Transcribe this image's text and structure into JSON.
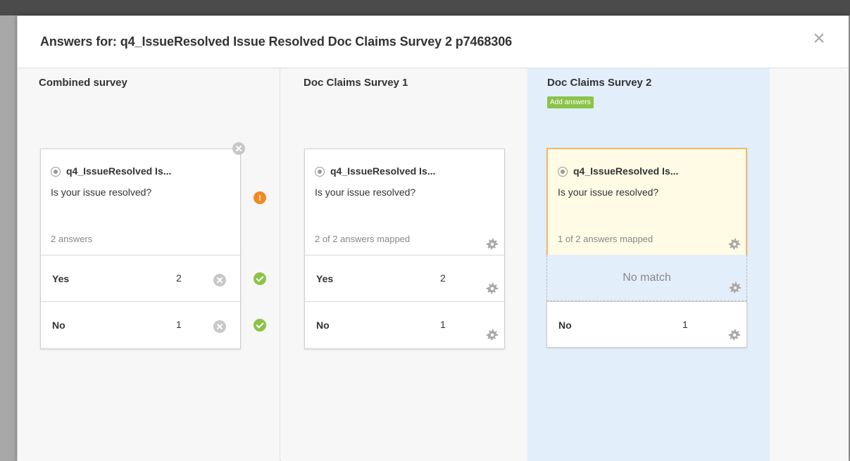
{
  "modal": {
    "title": "Answers for: q4_IssueResolved Issue Resolved Doc Claims Survey 2 p7468306",
    "close_label": "×"
  },
  "columns": [
    {
      "title": "Combined survey",
      "card": {
        "question_name": "q4_IssueResolved Is...",
        "question_text": "Is your issue resolved?",
        "meta": "2 answers",
        "answers": [
          {
            "label": "Yes",
            "count": "2",
            "status": "ok"
          },
          {
            "label": "No",
            "count": "1",
            "status": "ok"
          }
        ],
        "question_status": "!"
      }
    },
    {
      "title": "Doc Claims Survey 1",
      "card": {
        "question_name": "q4_IssueResolved Is...",
        "question_text": "Is your issue resolved?",
        "meta": "2 of 2 answers mapped",
        "answers": [
          {
            "label": "Yes",
            "count": "2"
          },
          {
            "label": "No",
            "count": "1"
          }
        ]
      }
    },
    {
      "title": "Doc Claims Survey 2",
      "add_answers_label": "Add answers",
      "card": {
        "question_name": "q4_IssueResolved Is...",
        "question_text": "Is your issue resolved?",
        "meta": "1 of 2 answers mapped",
        "no_match_label": "No match",
        "answers": [
          {
            "label": "No",
            "count": "1"
          }
        ]
      }
    }
  ],
  "colors": {
    "accent_green": "#8bc34a",
    "warn_orange": "#f08a24",
    "highlight_border": "#f5b86b",
    "active_column_bg": "#e2eefa"
  }
}
